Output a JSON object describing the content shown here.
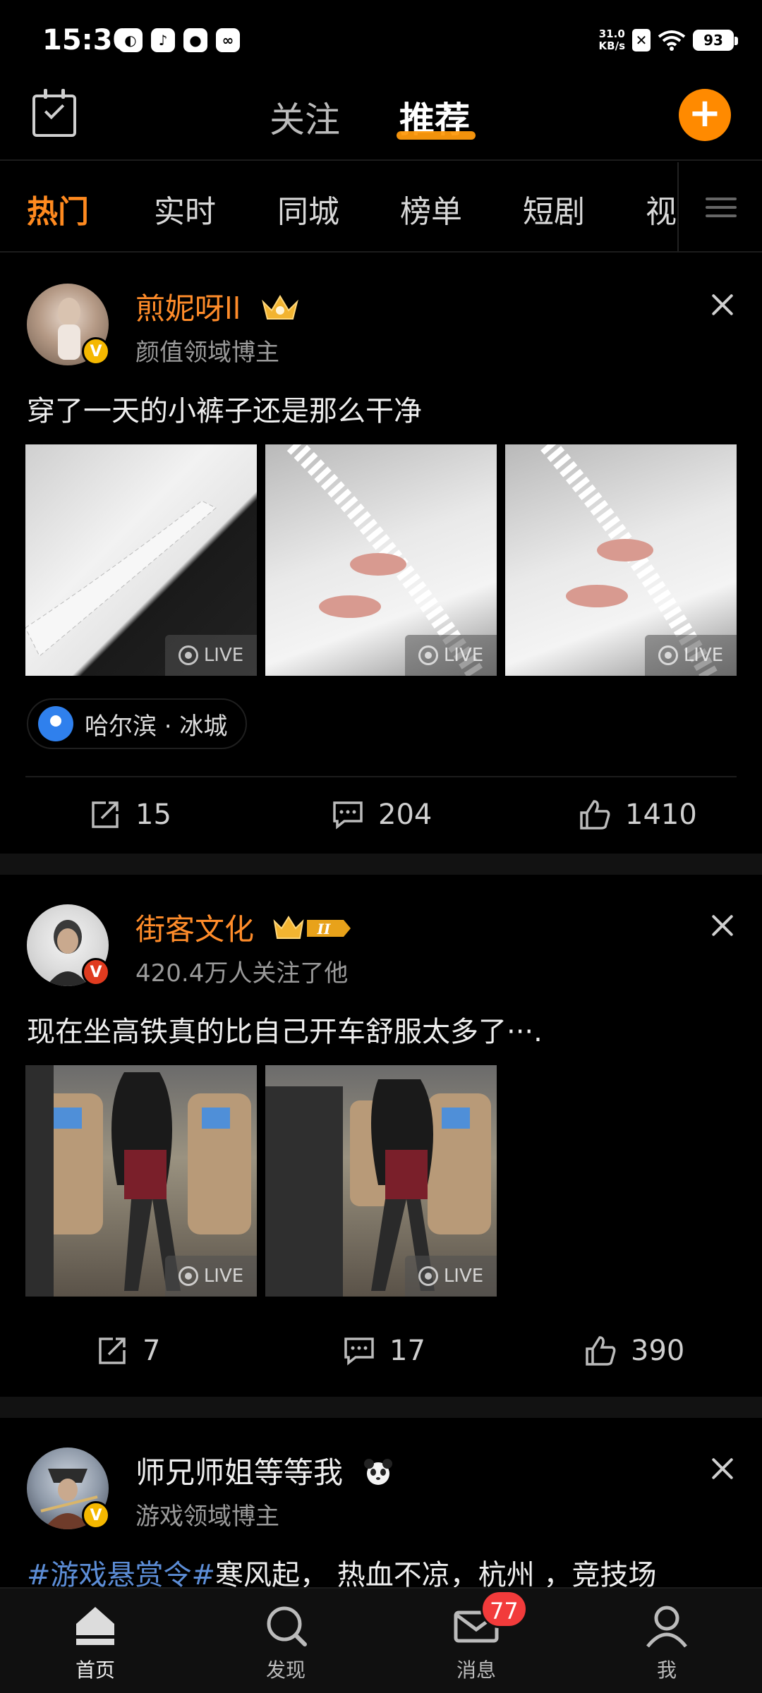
{
  "status_bar": {
    "time": "15:30",
    "net_speed_value": "31.0",
    "net_speed_unit": "KB/s",
    "battery": "93"
  },
  "top_nav": {
    "follow_label": "关注",
    "recommend_label": "推荐",
    "active_tab": "推荐"
  },
  "categories": {
    "items": [
      "热门",
      "实时",
      "同城",
      "榜单",
      "短剧",
      "视"
    ],
    "active": "热门"
  },
  "posts": [
    {
      "username": "煎妮呀ll",
      "subtitle": "颜值领域博主",
      "text": "穿了一天的小裤子还是那么干净",
      "image_count": 3,
      "live_label": "LIVE",
      "location": "哈尔滨 · 冰城",
      "reposts": "15",
      "comments": "204",
      "likes": "1410"
    },
    {
      "username": "街客文化",
      "subtitle": "420.4万人关注了他",
      "text": "现在坐高铁真的比自己开车舒服太多了···.",
      "image_count": 2,
      "live_label": "LIVE",
      "reposts": "7",
      "comments": "17",
      "likes": "390"
    },
    {
      "username": "师兄师姐等等我",
      "subtitle": "游戏领域博主",
      "topic": "#游戏悬赏令#",
      "text": "寒风起， 热血不凉，杭州 ，竞技场"
    }
  ],
  "bottom_tabs": {
    "home": "首页",
    "discover": "发现",
    "messages": "消息",
    "messages_badge": "77",
    "me": "我"
  },
  "colors": {
    "accent_orange": "#ff8a1f",
    "topic_blue": "#5c8dd6",
    "badge_red": "#f23b3b"
  }
}
